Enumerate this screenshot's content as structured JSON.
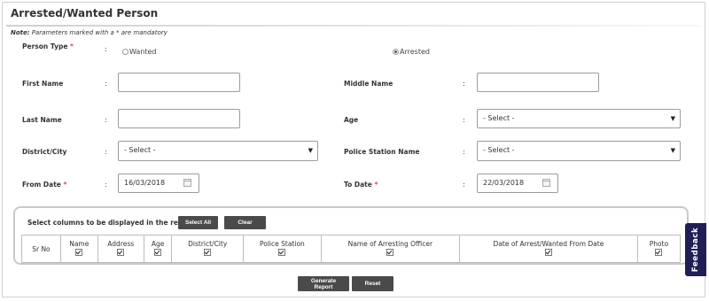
{
  "page": {
    "title": "Arrested/Wanted Person",
    "note_prefix": "Note:",
    "note_text": " Parameters marked with a * are mandatory",
    "required_mark": "*",
    "colon": ":"
  },
  "form": {
    "person_type": {
      "label": "Person Type",
      "options": [
        {
          "label": "Wanted",
          "selected": false
        },
        {
          "label": "Arrested",
          "selected": true
        }
      ]
    },
    "first_name": {
      "label": "First Name",
      "value": ""
    },
    "middle_name": {
      "label": "Middle Name",
      "value": ""
    },
    "last_name": {
      "label": "Last Name",
      "value": ""
    },
    "age": {
      "label": "Age",
      "value": "- Select -"
    },
    "district": {
      "label": "District/City",
      "value": "- Select -"
    },
    "police_station": {
      "label": "Police Station Name",
      "value": "- Select -"
    },
    "from_date": {
      "label": "From Date",
      "value": "16/03/2018"
    },
    "to_date": {
      "label": "To Date",
      "value": "22/03/2018"
    }
  },
  "columns_panel": {
    "title": "Select columns to be displayed in the report",
    "select_all_label": "Select All",
    "clear_label": "Clear",
    "columns": [
      {
        "label": "Sr No",
        "checkbox": false
      },
      {
        "label": "Name",
        "checkbox": true,
        "checked": true
      },
      {
        "label": "Address",
        "checkbox": true,
        "checked": true
      },
      {
        "label": "Age",
        "checkbox": true,
        "checked": true
      },
      {
        "label": "District/City",
        "checkbox": true,
        "checked": true
      },
      {
        "label": "Police Station",
        "checkbox": true,
        "checked": true
      },
      {
        "label": "Name of Arresting Officer",
        "checkbox": true,
        "checked": true
      },
      {
        "label": "Date of Arrest/Wanted From Date",
        "checkbox": true,
        "checked": true
      },
      {
        "label": "Photo",
        "checkbox": true,
        "checked": true
      }
    ]
  },
  "actions": {
    "generate_label": "Generate Report",
    "reset_label": "Reset"
  },
  "feedback": {
    "label": "Feedback"
  },
  "icons": {
    "dropdown": "chevron-down-icon",
    "calendar": "calendar-icon"
  },
  "colors": {
    "button_bg": "#4a4a4a",
    "feedback_bg": "#1f1f55",
    "required": "#d9534f"
  }
}
